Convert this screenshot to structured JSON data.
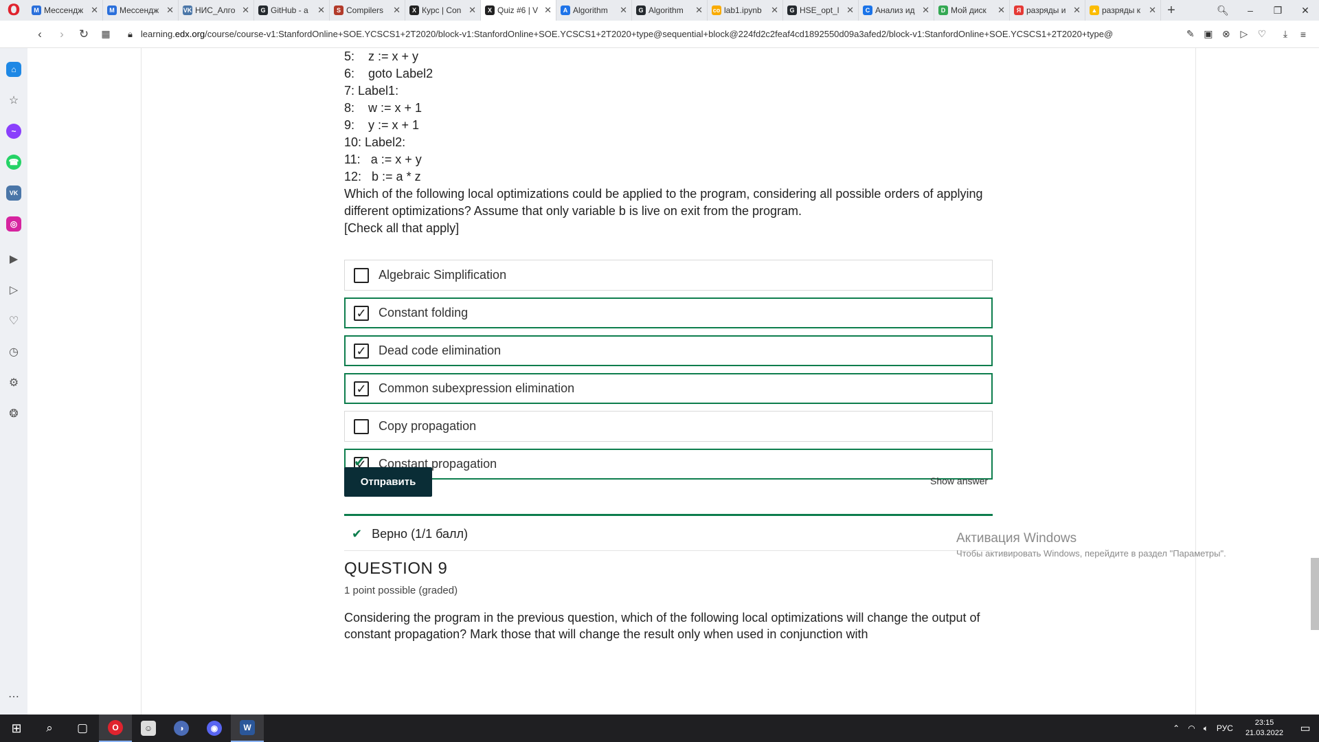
{
  "browser": {
    "tabs": [
      {
        "title": "Мессендж",
        "color": "#2a6fdb",
        "glyph": "M"
      },
      {
        "title": "Мессендж",
        "color": "#2a6fdb",
        "glyph": "M"
      },
      {
        "title": "НИС_Алго",
        "color": "#4a76a8",
        "glyph": "VK"
      },
      {
        "title": "GitHub - a",
        "color": "#24292e",
        "glyph": "G"
      },
      {
        "title": "Compilers",
        "color": "#b23a2a",
        "glyph": "S"
      },
      {
        "title": "Курс | Con",
        "color": "#222222",
        "glyph": "X"
      },
      {
        "title": "Quiz #6 | V",
        "color": "#222222",
        "glyph": "X"
      },
      {
        "title": "Algorithm",
        "color": "#1e73e8",
        "glyph": "A"
      },
      {
        "title": "Algorithm",
        "color": "#24292e",
        "glyph": "G"
      },
      {
        "title": "lab1.ipynb",
        "color": "#f9ab00",
        "glyph": "co"
      },
      {
        "title": "HSE_opt_l",
        "color": "#24292e",
        "glyph": "G"
      },
      {
        "title": "Анализ ид",
        "color": "#1a73e8",
        "glyph": "C"
      },
      {
        "title": "Мой диск",
        "color": "#34a853",
        "glyph": "D"
      },
      {
        "title": "разряды и",
        "color": "#e53935",
        "glyph": "Я"
      },
      {
        "title": "разряды к",
        "color": "#fbbc04",
        "glyph": "▲"
      }
    ],
    "active_tab": 6,
    "url_prefix": "learning.",
    "url_host": "edx.org",
    "url_rest": "/course/course-v1:StanfordOnline+SOE.YCSCS1+2T2020/block-v1:StanfordOnline+SOE.YCSCS1+2T2020+type@sequential+block@224fd2c2feaf4cd1892550d09a3afed2/block-v1:StanfordOnline+SOE.YCSCS1+2T2020+type@"
  },
  "problem": {
    "code_lines": [
      "5:    z := x + y",
      "6:    goto Label2",
      "7: Label1:",
      "8:    w := x + 1",
      "9:    y := x + 1",
      "10: Label2:",
      "11:   a := x + y",
      "12:   b := a * z"
    ],
    "question": "Which of the following local optimizations could be applied to the program, considering all possible orders of applying different optimizations? Assume that only variable b is live on exit from the program.",
    "instruction": "[Check all that apply]",
    "options": [
      {
        "label": "Algebraic Simplification",
        "checked": false
      },
      {
        "label": "Constant folding",
        "checked": true
      },
      {
        "label": "Dead code elimination",
        "checked": true
      },
      {
        "label": "Common subexpression elimination",
        "checked": true
      },
      {
        "label": "Copy propagation",
        "checked": false
      },
      {
        "label": "Constant propagation",
        "checked": true
      }
    ],
    "submit_label": "Отправить",
    "show_answer_label": "Show answer",
    "result_text": "Верно (1/1 балл)"
  },
  "next_question": {
    "title": "QUESTION 9",
    "points": "1 point possible (graded)",
    "text": "Considering the program in the previous question, which of the following local optimizations will change the output of constant propagation? Mark those that will change the result only when used in conjunction with"
  },
  "watermark": {
    "title": "Активация Windows",
    "subtitle": "Чтобы активировать Windows, перейдите в раздел \"Параметры\"."
  },
  "taskbar": {
    "language": "РУС",
    "time": "23:15",
    "date": "21.03.2022"
  },
  "colors": {
    "correct_green": "#0d7d4d",
    "submit_bg": "#0a2d36"
  }
}
